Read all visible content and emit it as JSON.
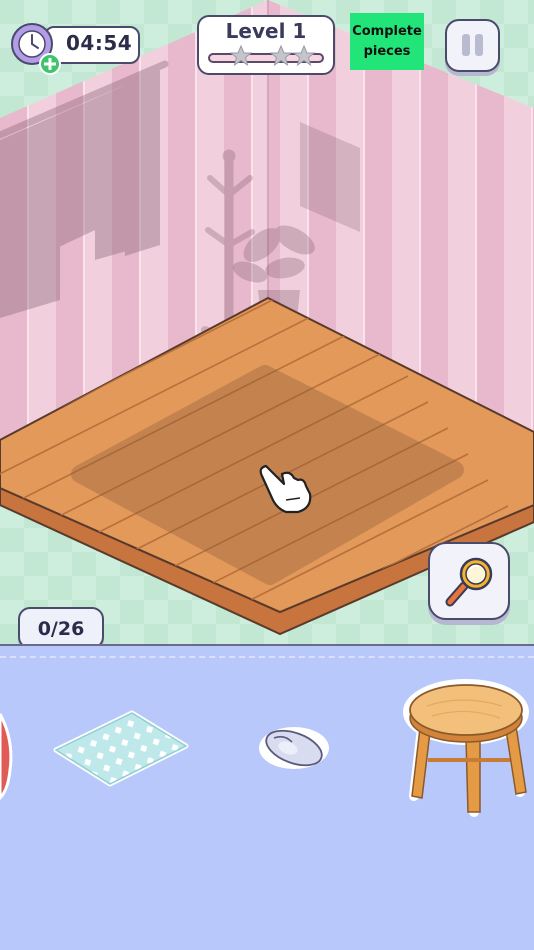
{
  "hud": {
    "timer": "04:54",
    "level_label": "Level 1",
    "stars_earned": 0,
    "stars_total": 3,
    "complete_pieces_line1": "Complete",
    "complete_pieces_line2": "pieces",
    "counter": "0/26"
  },
  "tray_items": [
    "rug",
    "computer-mouse",
    "wooden-stool"
  ],
  "colors": {
    "complete_button": "#22e57a",
    "tray_background": "#b8c8fb",
    "wall_pink": "#f0c8d8",
    "floor_wood": "#e2995a"
  }
}
